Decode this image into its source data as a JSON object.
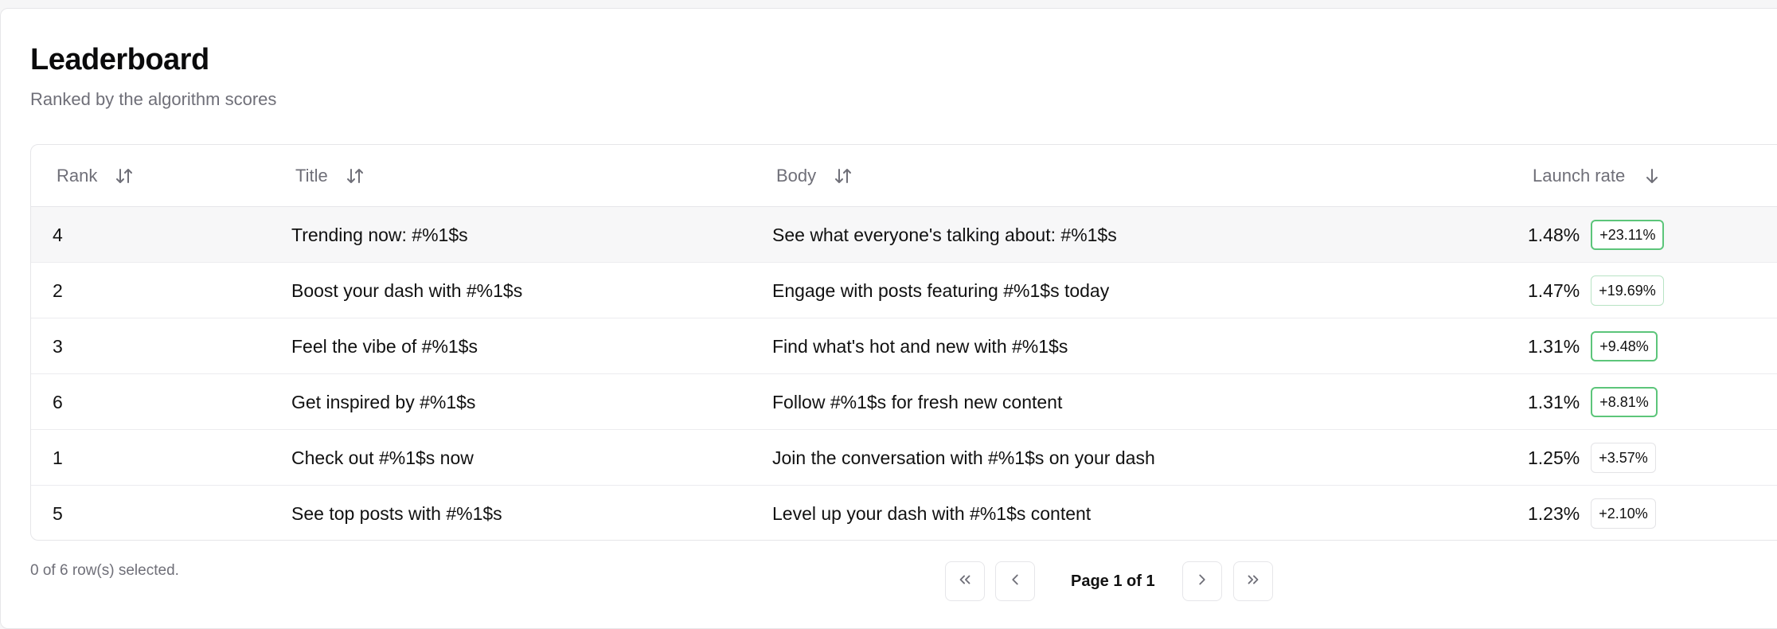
{
  "header": {
    "title": "Leaderboard",
    "subtitle": "Ranked by the algorithm scores"
  },
  "table": {
    "columns": {
      "rank": "Rank",
      "title": "Title",
      "body": "Body",
      "launch_rate": "Launch rate"
    },
    "sort_icons": {
      "rank": "sort-updown-icon",
      "title": "sort-updown-icon",
      "body": "sort-updown-icon",
      "launch_rate": "arrow-down-icon"
    },
    "rows": [
      {
        "rank": "4",
        "title": "Trending now: #%1$s",
        "body": "See what everyone's talking about: #%1$s",
        "rate": "1.48%",
        "delta": "+23.11%",
        "delta_color": "#5cc57a"
      },
      {
        "rank": "2",
        "title": "Boost your dash with #%1$s",
        "body": "Engage with posts featuring #%1$s today",
        "rate": "1.47%",
        "delta": "+19.69%",
        "delta_color": "#b8e3c4"
      },
      {
        "rank": "3",
        "title": "Feel the vibe of #%1$s",
        "body": "Find what's hot and new with #%1$s",
        "rate": "1.31%",
        "delta": "+9.48%",
        "delta_color": "#5cc57a"
      },
      {
        "rank": "6",
        "title": "Get inspired by #%1$s",
        "body": "Follow #%1$s for fresh new content",
        "rate": "1.31%",
        "delta": "+8.81%",
        "delta_color": "#5cc57a"
      },
      {
        "rank": "1",
        "title": "Check out #%1$s now",
        "body": "Join the conversation with #%1$s on your dash",
        "rate": "1.25%",
        "delta": "+3.57%",
        "delta_color": "#e3e3e6"
      },
      {
        "rank": "5",
        "title": "See top posts with #%1$s",
        "body": "Level up your dash with #%1$s content",
        "rate": "1.23%",
        "delta": "+2.10%",
        "delta_color": "#e3e3e6"
      }
    ],
    "highlighted_row": 0
  },
  "footer": {
    "selection_text": "0 of 6 row(s) selected.",
    "page_label": "Page 1 of 1",
    "buttons": {
      "first": "chevrons-left-icon",
      "prev": "chevron-left-icon",
      "next": "chevron-right-icon",
      "last": "chevrons-right-icon"
    }
  }
}
